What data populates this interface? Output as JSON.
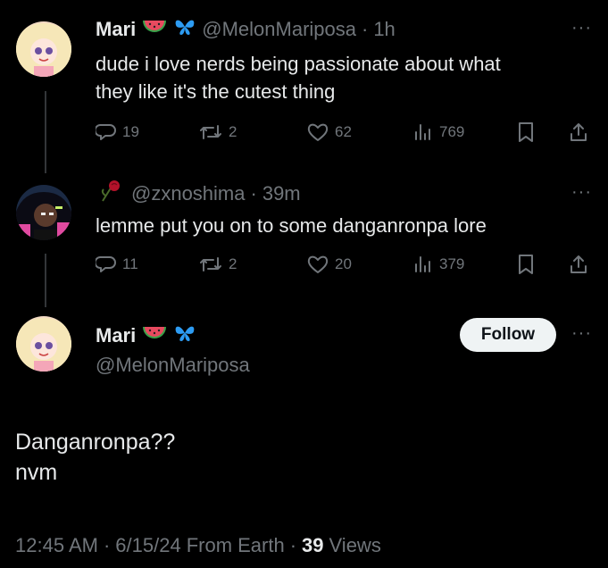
{
  "tweets": [
    {
      "name": "Mari",
      "handle": "@MelonMariposa",
      "separator": "·",
      "time": "1h",
      "text_line1": "dude i love nerds being passionate about what",
      "text_line2": "they like it's the cutest thing",
      "replies": "19",
      "retweets": "2",
      "likes": "62",
      "views": "769"
    },
    {
      "handle": "@zxnoshima",
      "separator": "·",
      "time": "39m",
      "text": "lemme put you on to some danganronpa lore",
      "replies": "11",
      "retweets": "2",
      "likes": "20",
      "views": "379"
    }
  ],
  "main_tweet": {
    "name": "Mari",
    "handle": "@MelonMariposa",
    "follow_label": "Follow",
    "text_line1": "Danganronpa??",
    "text_line2": "nvm",
    "time": "12:45 AM",
    "date": "6/15/24",
    "source": "From Earth",
    "views_count": "39",
    "views_label": "Views",
    "separator": "·"
  },
  "more_glyph": "···",
  "colors": {
    "background": "#000000",
    "text": "#e7e9ea",
    "secondary": "#71767b",
    "thread_line": "#333639",
    "follow_bg": "#eff3f4",
    "butterfly": "#2d9cf3"
  }
}
